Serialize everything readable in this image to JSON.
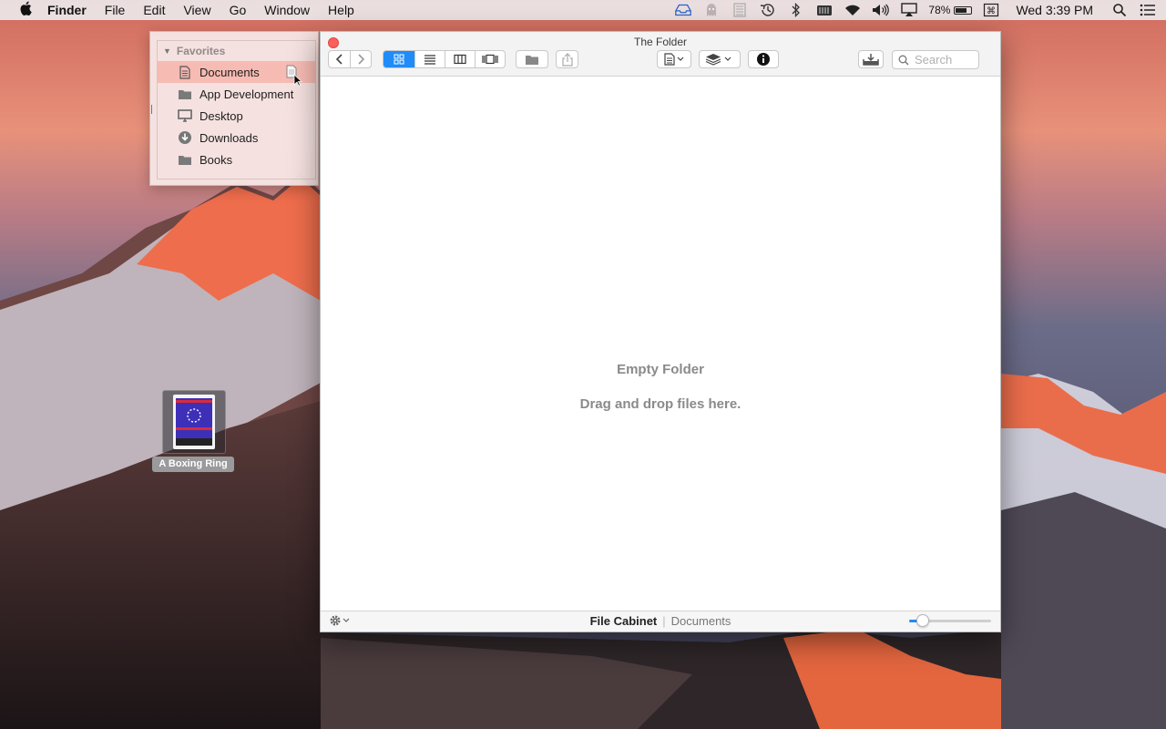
{
  "menubar": {
    "app_name": "Finder",
    "items": [
      "File",
      "Edit",
      "View",
      "Go",
      "Window",
      "Help"
    ],
    "battery_percent": "78%",
    "battery_level": 0.78,
    "clock": "Wed 3:39 PM",
    "status_icons": [
      "inbox-tray-icon",
      "ghost-icon",
      "document-stack-icon",
      "time-machine-icon",
      "bluetooth-icon",
      "memory-icon",
      "wifi-icon",
      "volume-icon",
      "airplay-icon",
      "battery-icon",
      "keyboard-command-icon",
      "spotlight-icon",
      "notification-center-icon"
    ]
  },
  "sidebar": {
    "section_title": "Favorites",
    "items": [
      {
        "label": "Documents",
        "icon": "document-icon",
        "selected": true
      },
      {
        "label": "App Development",
        "icon": "folder-icon"
      },
      {
        "label": "Desktop",
        "icon": "desktop-icon"
      },
      {
        "label": "Downloads",
        "icon": "downloads-icon"
      },
      {
        "label": "Books",
        "icon": "folder-icon"
      }
    ]
  },
  "desktop_file": {
    "label": "A Boxing Ring"
  },
  "window": {
    "title": "The Folder",
    "search_placeholder": "Search",
    "active_view": "icon",
    "empty_title": "Empty Folder",
    "empty_subtitle": "Drag and drop files here.",
    "path_current": "File Cabinet",
    "path_parent": "Documents",
    "zoom_level": 0.17,
    "accent_color": "#1f8cf9"
  }
}
